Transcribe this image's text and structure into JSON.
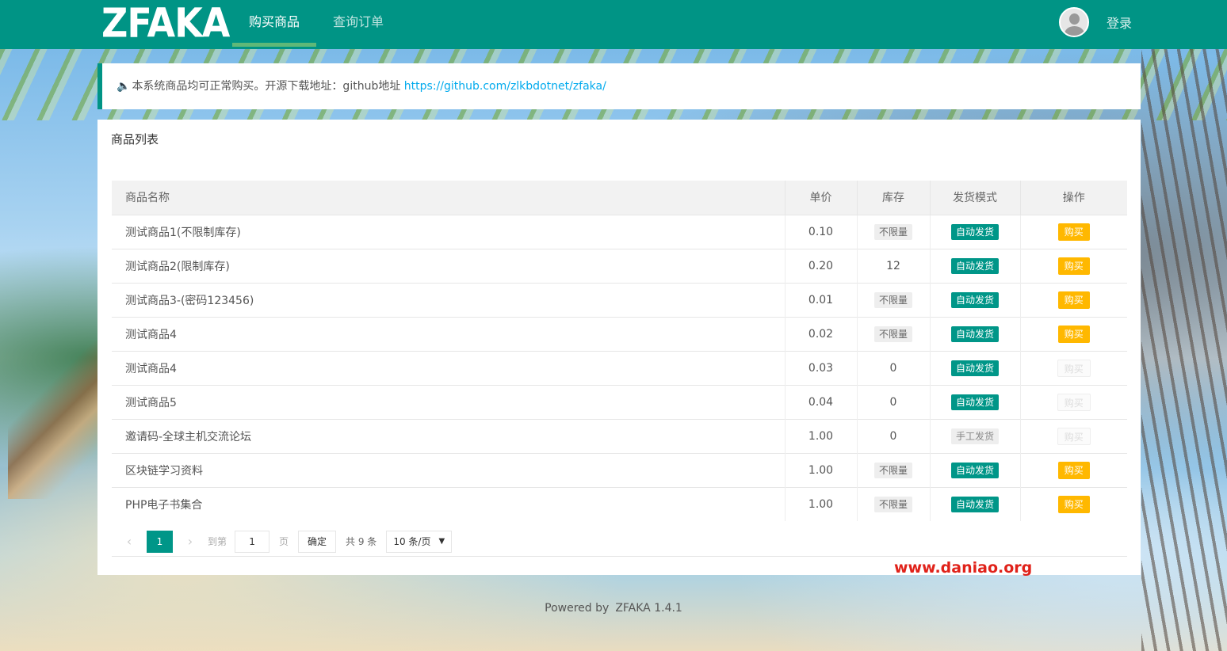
{
  "header": {
    "logo": "ZFAKA",
    "nav": [
      {
        "label": "购买商品",
        "active": true
      },
      {
        "label": "查询订单",
        "active": false
      }
    ],
    "login_label": "登录"
  },
  "notice": {
    "icon": "volume-icon",
    "text": "本系统商品均可正常购买。开源下载地址：github地址",
    "link": "https://github.com/zlkbdotnet/zfaka/"
  },
  "panel": {
    "title": "商品列表",
    "columns": [
      "商品名称",
      "单价",
      "库存",
      "发货模式",
      "操作"
    ],
    "rows": [
      {
        "name": "测试商品1(不限制库存)",
        "price": "0.10",
        "stock": "不限量",
        "mode": "自动发货",
        "action": "购买",
        "enabled": true
      },
      {
        "name": "测试商品2(限制库存)",
        "price": "0.20",
        "stock": "12",
        "mode": "自动发货",
        "action": "购买",
        "enabled": true
      },
      {
        "name": "测试商品3-(密码123456)",
        "price": "0.01",
        "stock": "不限量",
        "mode": "自动发货",
        "action": "购买",
        "enabled": true
      },
      {
        "name": "测试商品4",
        "price": "0.02",
        "stock": "不限量",
        "mode": "自动发货",
        "action": "购买",
        "enabled": true
      },
      {
        "name": "测试商品4",
        "price": "0.03",
        "stock": "0",
        "mode": "自动发货",
        "action": "购买",
        "enabled": false
      },
      {
        "name": "测试商品5",
        "price": "0.04",
        "stock": "0",
        "mode": "自动发货",
        "action": "购买",
        "enabled": false
      },
      {
        "name": "邀请码-全球主机交流论坛",
        "price": "1.00",
        "stock": "0",
        "mode": "手工发货",
        "action": "购买",
        "enabled": false
      },
      {
        "name": "区块链学习资料",
        "price": "1.00",
        "stock": "不限量",
        "mode": "自动发货",
        "action": "购买",
        "enabled": true
      },
      {
        "name": "PHP电子书集合",
        "price": "1.00",
        "stock": "不限量",
        "mode": "自动发货",
        "action": "购买",
        "enabled": true
      }
    ]
  },
  "pager": {
    "current_page": "1",
    "goto_label": "到第",
    "input_value": "1",
    "page_label": "页",
    "confirm_label": "确定",
    "total": "共 9 条",
    "page_size": "10 条/页"
  },
  "watermark": "www.daniao.org",
  "footer": {
    "powered": "Powered by",
    "version": "ZFAKA 1.4.1"
  },
  "colors": {
    "primary": "#009485",
    "buy": "#ffb800",
    "link": "#01aaed"
  }
}
